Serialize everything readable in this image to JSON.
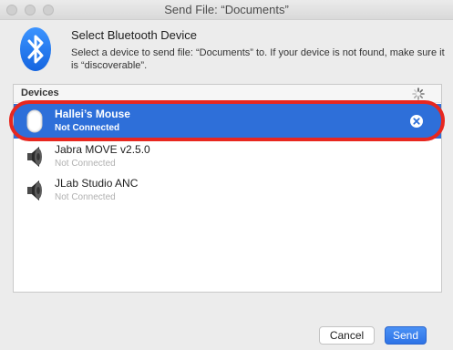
{
  "window": {
    "title": "Send File: “Documents”"
  },
  "header": {
    "heading": "Select Bluetooth Device",
    "description": "Select a device to send file: “Documents” to. If your device is not found, make sure it is “discoverable”."
  },
  "devices": {
    "header_label": "Devices",
    "items": [
      {
        "name": "Hallei’s Mouse",
        "status": "Not Connected",
        "icon": "mouse-icon",
        "selected": true
      },
      {
        "name": "Jabra MOVE v2.5.0",
        "status": "Not Connected",
        "icon": "speaker-icon",
        "selected": false
      },
      {
        "name": "JLab Studio ANC",
        "status": "Not Connected",
        "icon": "speaker-icon",
        "selected": false
      }
    ]
  },
  "footer": {
    "cancel_label": "Cancel",
    "send_label": "Send"
  },
  "colors": {
    "selection": "#2e6fd9",
    "highlight_outline": "#e8271f",
    "bluetooth_blue": "#1f7bf2"
  }
}
